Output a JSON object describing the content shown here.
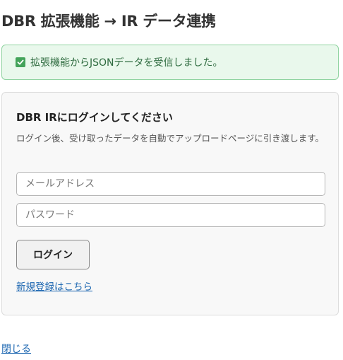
{
  "page": {
    "title": "DBR 拡張機能 → IR データ連携"
  },
  "alert": {
    "icon": "check-icon",
    "message": "拡張機能からJSONデータを受信しました。",
    "color": "#43a35a"
  },
  "login": {
    "title": "DBR IRにログインしてください",
    "description": "ログイン後、受け取ったデータを自動でアップロードページに引き渡します。",
    "email_placeholder": "メールアドレス",
    "password_placeholder": "パスワード",
    "submit_label": "ログイン",
    "register_link": "新規登録はこちら"
  },
  "footer": {
    "close_link": "閉じる"
  }
}
